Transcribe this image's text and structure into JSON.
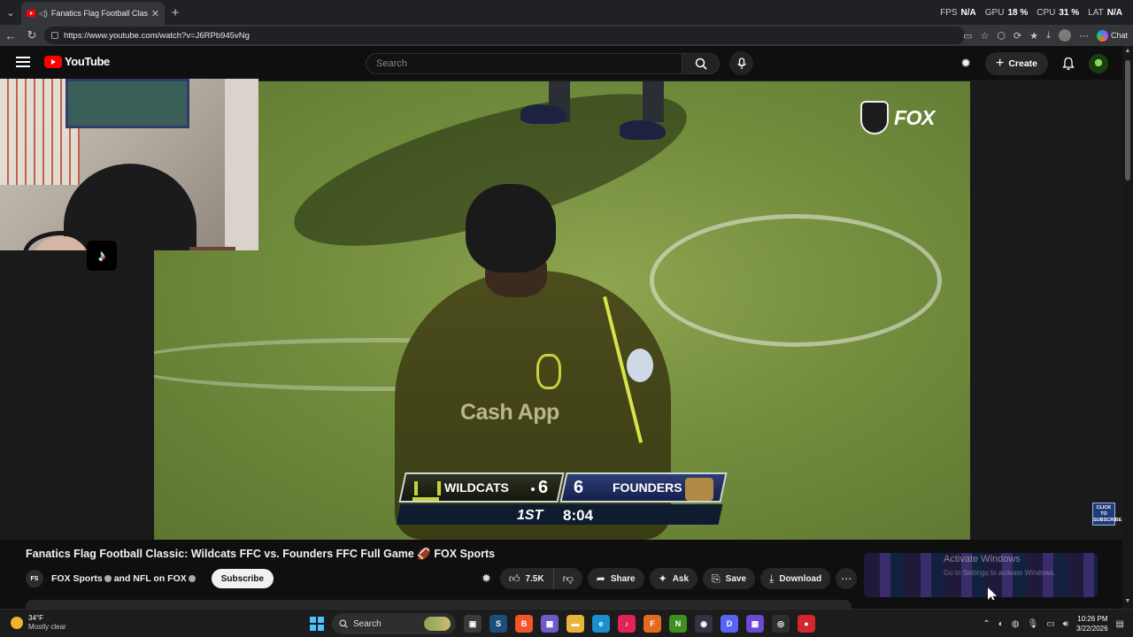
{
  "browser": {
    "tab_title": "Fanatics Flag Football Classic",
    "url": "https://www.youtube.com/watch?v=J6RPb945vNg",
    "chat_label": "Chat"
  },
  "overlay_stats": [
    {
      "key": "FPS",
      "value": "N/A"
    },
    {
      "key": "GPU",
      "value": "18 %"
    },
    {
      "key": "CPU",
      "value": "31 %"
    },
    {
      "key": "LAT",
      "value": "N/A"
    }
  ],
  "youtube": {
    "logo_text": "YouTube",
    "search_placeholder": "Search",
    "create_label": "Create"
  },
  "video_overlay": {
    "network": "FOX",
    "click_to_subscribe": "CLICK TO SUBSCRIBE",
    "jersey_sponsor": "Cash App"
  },
  "scoreboard": {
    "home_team": "WILDCATS",
    "home_score": "6",
    "away_team": "FOUNDERS",
    "away_score": "6",
    "quarter": "1ST",
    "clock": "8:04"
  },
  "video": {
    "title": "Fanatics Flag Football Classic: Wildcats FFC vs. Founders FFC Full Game 🏈 FOX Sports",
    "channel": "FOX Sports",
    "channel_and": "and",
    "collab": "NFL on FOX",
    "subscribe_label": "Subscribe",
    "likes": "7.5K",
    "share_label": "Share",
    "ask_label": "Ask",
    "save_label": "Save",
    "download_label": "Download"
  },
  "windows_watermark": {
    "title": "Activate Windows",
    "subtitle": "Go to Settings to activate Windows."
  },
  "taskbar": {
    "temperature": "34°F",
    "condition": "Mostly clear",
    "search_label": "Search",
    "time": "10:26 PM",
    "date": "3/22/2026"
  },
  "colors": {
    "youtube_red": "#ff0000",
    "background": "#0f0f0f",
    "wildcats_accent": "#c8d23e",
    "founders_blue": "#2d3e77"
  }
}
